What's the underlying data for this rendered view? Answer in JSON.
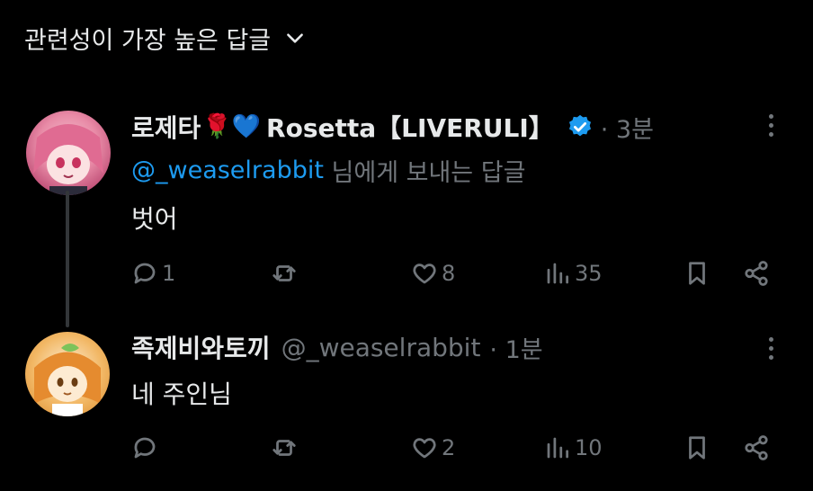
{
  "header": {
    "sort_label": "관련성이 가장 높은 답글"
  },
  "replies": [
    {
      "display_name": "로제타",
      "name_emoji": "🌹💙",
      "name_suffix": "Rosetta【LIVERULI】",
      "verified": true,
      "time": "· 3분",
      "reply_prefix": "@_weaselrabbit",
      "reply_suffix": " 님에게 보내는 답글",
      "text": "벗어",
      "counts": {
        "replies": "1",
        "reposts": "",
        "likes": "8",
        "views": "35"
      }
    },
    {
      "display_name": "족제비와토끼",
      "handle": "@_weaselrabbit",
      "time": "· 1분",
      "text": "네 주인님",
      "counts": {
        "replies": "",
        "reposts": "",
        "likes": "2",
        "views": "10"
      }
    }
  ],
  "colors": {
    "accent": "#1d9bf0",
    "muted": "#71767b",
    "text": "#e7e9ea",
    "background": "#000000"
  }
}
